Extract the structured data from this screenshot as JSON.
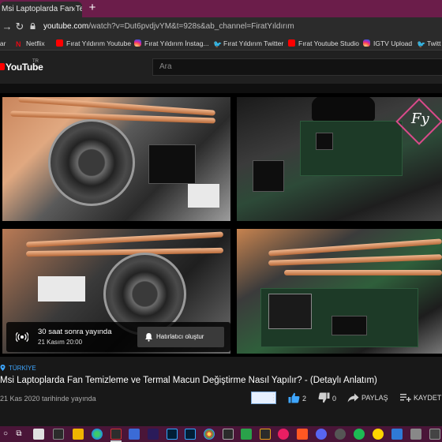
{
  "browser": {
    "tab_title": "Msi Laptoplarda Fan Temizleme ve",
    "tab_close": "×",
    "new_tab": "+",
    "url_domain": "youtube.com",
    "url_rest": "/watch?v=Dut6pvdjvYM&t=928s&ab_channel=FiratYıldırım"
  },
  "bookmarks": [
    {
      "label": "lar",
      "icon": "none"
    },
    {
      "label": "Netflix",
      "icon": "netflix-icon"
    },
    {
      "label": "Fırat Yıldırım Youtube",
      "icon": "youtube-icon"
    },
    {
      "label": "Fırat Yıldırım İnstag...",
      "icon": "instagram-icon"
    },
    {
      "label": "Fırat Yıldırım Twitter",
      "icon": "twitter-icon"
    },
    {
      "label": "Fırat Youtube Studio",
      "icon": "youtube-icon"
    },
    {
      "label": "IGTV Upload",
      "icon": "instagram-icon"
    },
    {
      "label": "Twitt",
      "icon": "twitter-icon"
    }
  ],
  "youtube": {
    "logo_text": "YouTube",
    "country_code": "TR",
    "search_placeholder": "Ara"
  },
  "player": {
    "premiere_title": "30 saat sonra yayında",
    "premiere_date": "21 Kasım 20:00",
    "remind_label": "Hatırlatıcı oluştur",
    "watermark": "Fy"
  },
  "video": {
    "tag": "TÜRKİYE",
    "title": "Msi Laptoplarda Fan Temizleme ve Termal Macun Değiştirme Nasıl Yapılır? - (Detaylı Anlatım)",
    "date": "21 Kas 2020 tarihinde yayında",
    "more": "⋮",
    "likes": "2",
    "dislikes": "0",
    "share": "PAYLAŞ",
    "save": "KAYDET"
  },
  "colors": {
    "tab_strip": "#6b1d4a",
    "taskbar": "#4a1538",
    "accent_blue": "#3ea6ff",
    "youtube_red": "#ff0000"
  }
}
